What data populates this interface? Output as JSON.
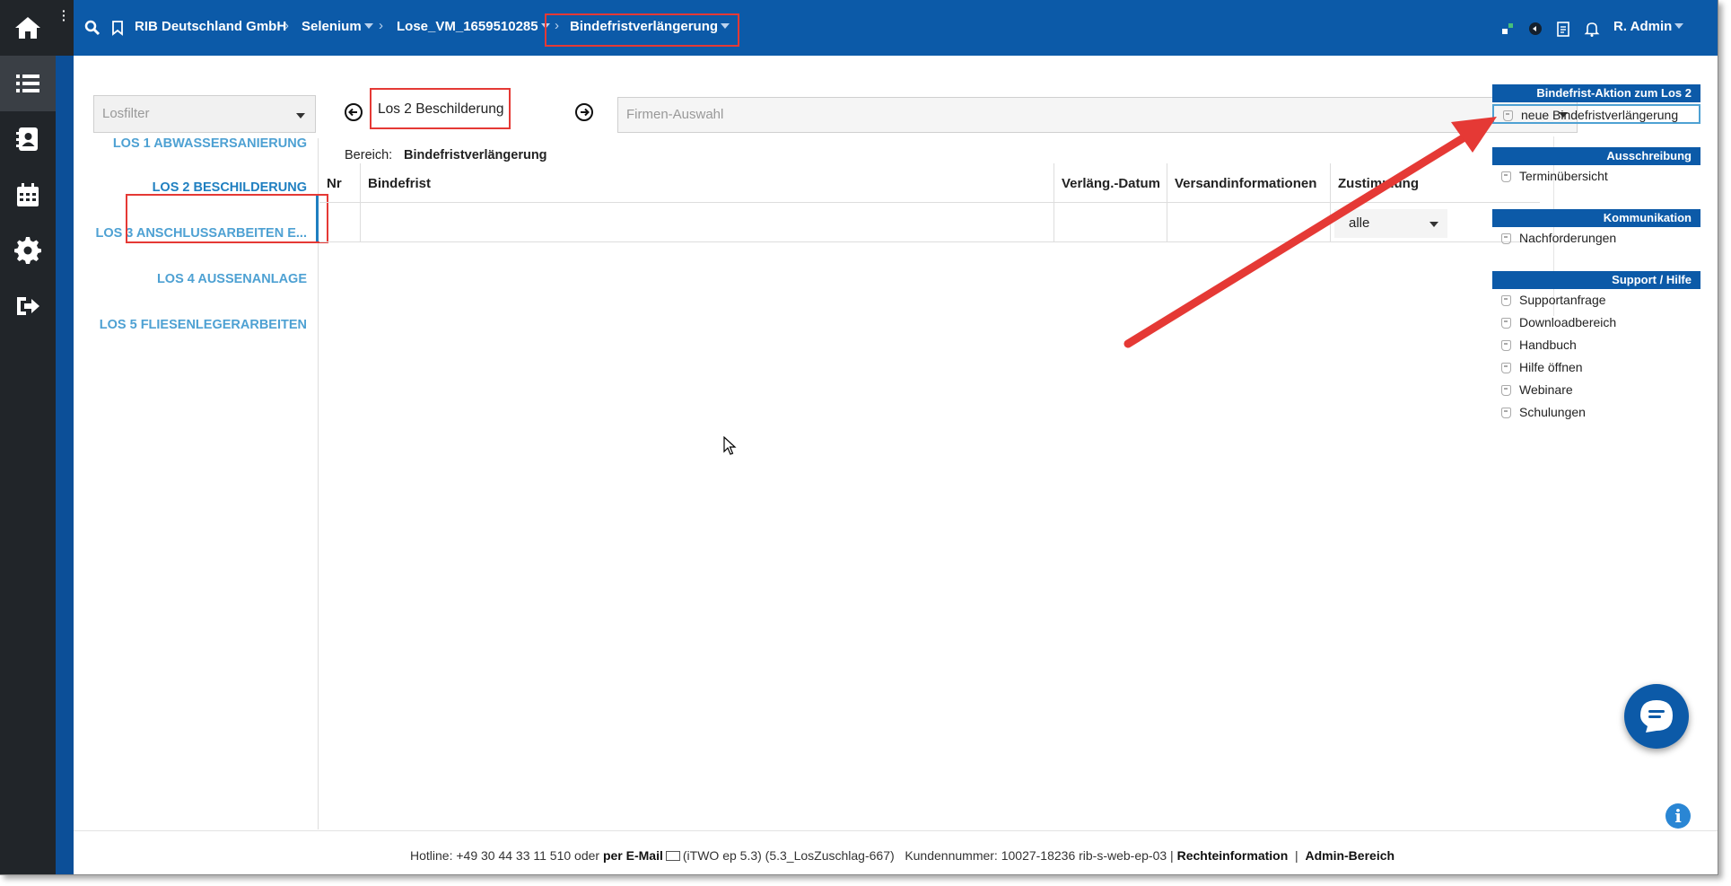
{
  "header": {
    "breadcrumbs": [
      {
        "label": "RIB Deutschland GmbH",
        "has_caret": false
      },
      {
        "label": "Selenium",
        "has_caret": true
      },
      {
        "label": "Lose_VM_1659510285",
        "has_caret": true
      },
      {
        "label": "Bindefristverlängerung",
        "has_caret": true
      }
    ],
    "user_label": "R. Admin",
    "icons": [
      "search-icon",
      "bookmark-icon",
      "apps-icon",
      "plugin-icon",
      "clipboard-icon",
      "bell-icon"
    ]
  },
  "rail": {
    "items": [
      "home-icon",
      "list-icon",
      "contacts-icon",
      "calendar-icon",
      "gear-icon",
      "logout-icon"
    ],
    "active_index": 1
  },
  "losfilter": {
    "placeholder": "Losfilter"
  },
  "los_list": [
    {
      "label": "LOS 1 ABWASSERSANIERUNG",
      "active": false
    },
    {
      "label": "LOS 2 BESCHILDERUNG",
      "active": true
    },
    {
      "label": "LOS 3 ANSCHLUSSARBEITEN E...",
      "active": false
    },
    {
      "label": "LOS 4 AUSSENANLAGE",
      "active": false
    },
    {
      "label": "LOS 5 FLIESENLEGERARBEITEN",
      "active": false
    }
  ],
  "main": {
    "los_title": "Los 2 Beschilderung",
    "firmen_placeholder": "Firmen-Auswahl",
    "bereich_label": "Bereich:",
    "bereich_value": "Bindefristverlängerung"
  },
  "grid": {
    "columns": [
      "Nr",
      "Bindefrist",
      "Verläng.-Datum",
      "Versandinformationen",
      "Zustimmung"
    ],
    "filter_value": "alle"
  },
  "sidebar": {
    "sections": [
      {
        "title": "Bindefrist-Aktion zum Los 2",
        "items": [
          "neue Bindefristverlängerung"
        ]
      },
      {
        "title": "Ausschreibung",
        "items": [
          "Terminübersicht"
        ]
      },
      {
        "title": "Kommunikation",
        "items": [
          "Nachforderungen"
        ]
      },
      {
        "title": "Support / Hilfe",
        "items": [
          "Supportanfrage",
          "Downloadbereich",
          "Handbuch",
          "Hilfe öffnen",
          "Webinare",
          "Schulungen"
        ]
      }
    ]
  },
  "footer": {
    "hotline": "Hotline: +49 30 44 33 11 510 oder",
    "email_link": "per E-Mail",
    "version": "(iTWO ep 5.3) (5.3_LosZuschlag-667)",
    "kunde": "Kundennummer: 10027-18236 rib-s-web-ep-03 |",
    "rechte": "Rechteinformation",
    "divider": "|",
    "admin": "Admin-Bereich"
  },
  "colors": {
    "header_blue": "#0c5aa8",
    "rail_dark": "#212529",
    "link_blue": "#4ea1d3",
    "annotation_red": "#e53935"
  }
}
